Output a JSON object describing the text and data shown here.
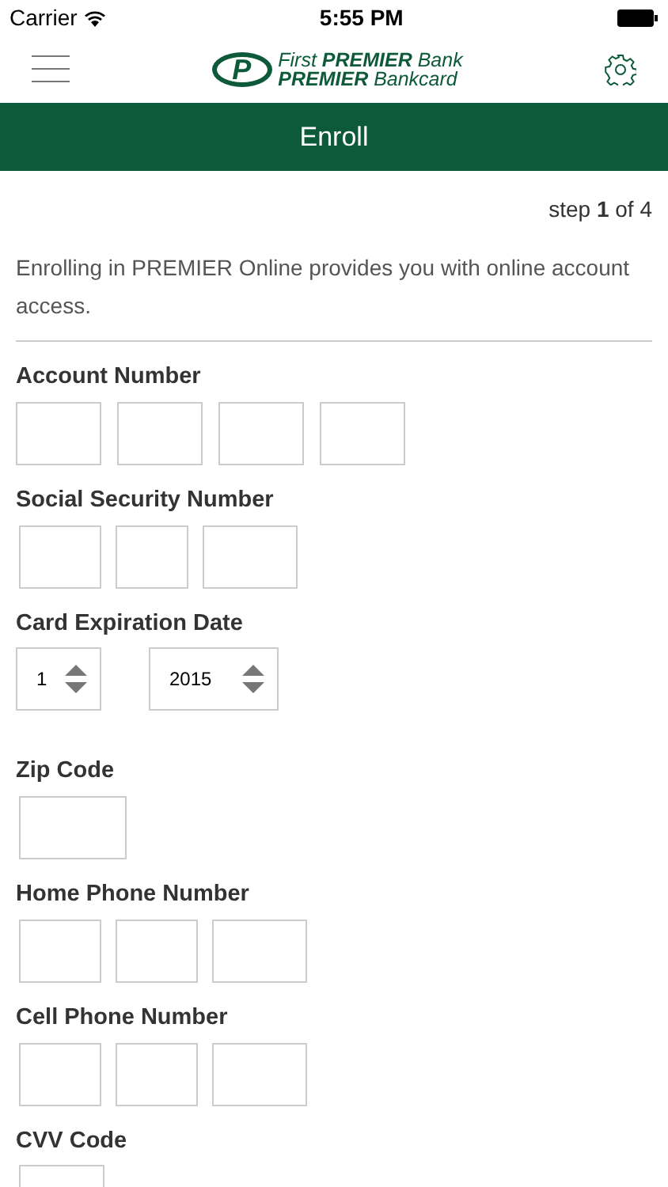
{
  "status_bar": {
    "carrier": "Carrier",
    "time": "5:55 PM"
  },
  "header": {
    "logo_lines": [
      "First **PREMIER** Bank",
      "**PREMIER** Bankcard"
    ],
    "emblem": "P"
  },
  "title": "Enroll",
  "step": "step **1** of 4",
  "intro": "Enrolling in PREMIER Online provides you with online account access.",
  "groups": [
    {
      "label": "Account Number",
      "fields": [
        {
          "kind": "text"
        },
        {
          "kind": "text"
        },
        {
          "kind": "text"
        },
        {
          "kind": "text"
        }
      ]
    },
    {
      "label": "Social Security Number",
      "fields": [
        {
          "kind": "text"
        },
        {
          "kind": "text"
        },
        {
          "kind": "text"
        }
      ]
    },
    {
      "label": "Card Expiration Date",
      "fields": [
        {
          "kind": "select",
          "value": "1"
        },
        {
          "kind": "select",
          "value": "2015"
        }
      ]
    },
    {
      "label": "Zip Code",
      "fields": [
        {
          "kind": "text"
        }
      ]
    },
    {
      "label": "Home Phone Number",
      "fields": [
        {
          "kind": "text"
        },
        {
          "kind": "text"
        },
        {
          "kind": "text"
        }
      ]
    },
    {
      "label": "Cell Phone Number",
      "fields": [
        {
          "kind": "text"
        },
        {
          "kind": "text"
        },
        {
          "kind": "text"
        }
      ]
    },
    {
      "label": "CVV Code",
      "fields": [
        {
          "kind": "text"
        }
      ]
    }
  ]
}
